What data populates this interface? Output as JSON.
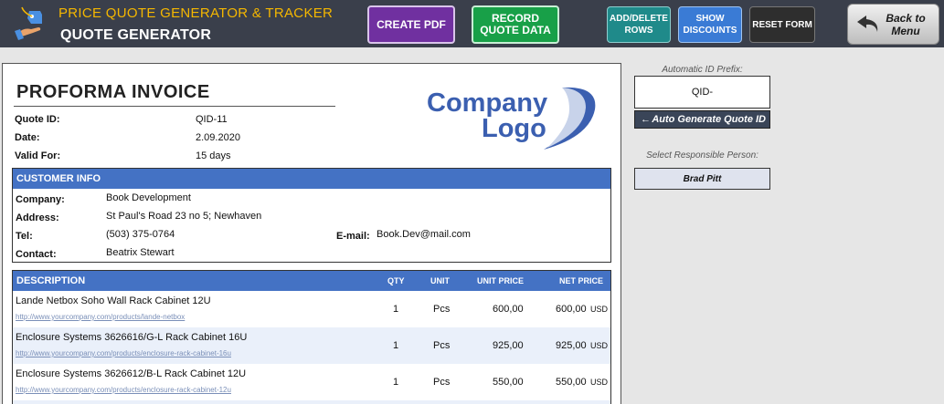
{
  "header": {
    "app_title": "PRICE QUOTE GENERATOR & TRACKER",
    "subtitle": "QUOTE GENERATOR",
    "buttons": {
      "create_pdf": "CREATE PDF",
      "record_quote": "RECORD QUOTE DATA",
      "add_delete_rows": "ADD/DELETE ROWS",
      "show_discounts": "SHOW DISCOUNTS",
      "reset_form": "RESET FORM",
      "back_to_menu": "Back to Menu"
    }
  },
  "invoice": {
    "title": "PROFORMA INVOICE",
    "fields": [
      {
        "label": "Quote ID:",
        "value": "QID-11"
      },
      {
        "label": "Date:",
        "value": "2.09.2020"
      },
      {
        "label": "Valid For:",
        "value": "15 days"
      }
    ],
    "logo": {
      "line1": "Company",
      "line2": "Logo"
    },
    "customer": {
      "heading": "CUSTOMER INFO",
      "company_label": "Company:",
      "company": "Book Development",
      "address_label": "Address:",
      "address": "St Paul's Road 23 no 5; Newhaven",
      "tel_label": "Tel:",
      "tel": "(503) 375-0764",
      "email_label": "E-mail:",
      "email": "Book.Dev@mail.com",
      "contact_label": "Contact:",
      "contact": "Beatrix Stewart"
    },
    "items_header": {
      "description": "DESCRIPTION",
      "qty": "QTY",
      "unit": "UNIT",
      "unit_price": "UNIT PRICE",
      "net_price": "NET PRICE"
    },
    "items": [
      {
        "name": "Lande Netbox Soho Wall Rack Cabinet 12U",
        "link": "http://www.yourcompany.com/products/lande-netbox",
        "qty": "1",
        "unit": "Pcs",
        "unit_price": "600,00",
        "net_price": "600,00",
        "currency": "USD"
      },
      {
        "name": "Enclosure Systems 3626616/G-L Rack Cabinet 16U",
        "link": "http://www.yourcompany.com/products/enclosure-rack-cabinet-16u",
        "qty": "1",
        "unit": "Pcs",
        "unit_price": "925,00",
        "net_price": "925,00",
        "currency": "USD"
      },
      {
        "name": "Enclosure Systems 3626612/B-L Rack Cabinet 12U",
        "link": "http://www.yourcompany.com/products/enclosure-rack-cabinet-12u",
        "qty": "1",
        "unit": "Pcs",
        "unit_price": "550,00",
        "net_price": "550,00",
        "currency": "USD"
      }
    ]
  },
  "side": {
    "prefix_label": "Automatic ID Prefix:",
    "prefix_value": "QID-",
    "generate_button": "Auto Generate Quote ID",
    "person_label": "Select Responsible Person:",
    "person_value": "Brad Pitt"
  },
  "colors": {
    "header_bg": "#3a3f4b",
    "title_accent": "#f5b700",
    "table_header": "#4472c4",
    "row_alt": "#eaf0fa",
    "create_pdf": "#7030a0",
    "record_quote": "#18a048"
  }
}
